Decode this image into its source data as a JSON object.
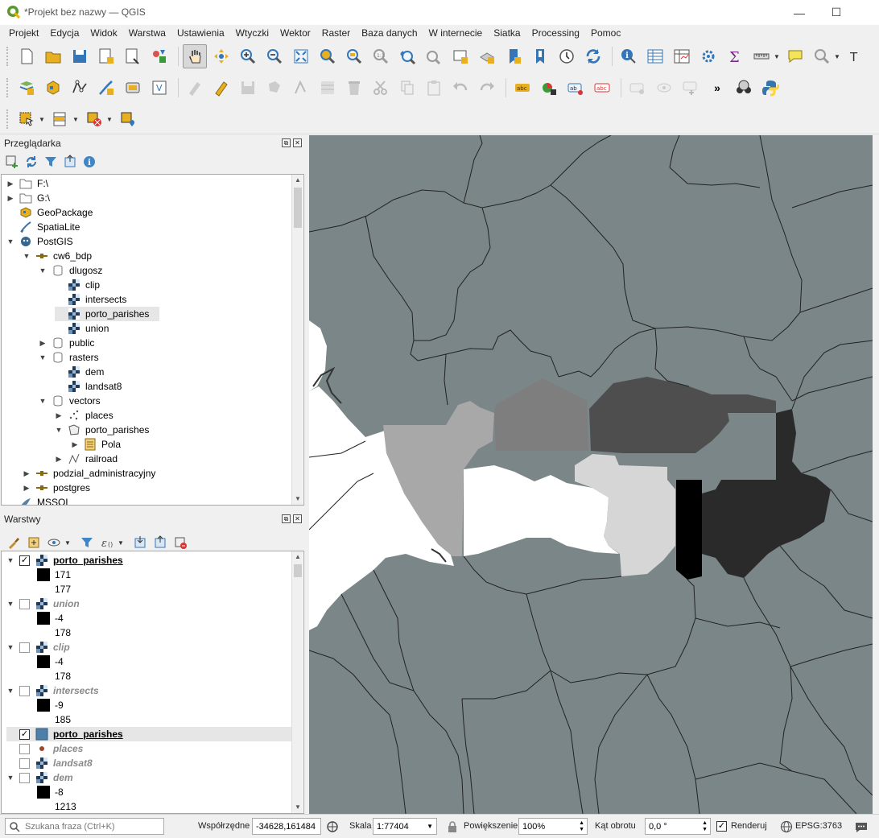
{
  "window": {
    "title": "*Projekt bez nazwy — QGIS",
    "minimize": "—",
    "maximize": "☐"
  },
  "menu": [
    "Projekt",
    "Edycja",
    "Widok",
    "Warstwa",
    "Ustawienia",
    "Wtyczki",
    "Wektor",
    "Raster",
    "Baza danych",
    "W internecie",
    "Siatka",
    "Processing",
    "Pomoc"
  ],
  "toolbar_overflow": "»",
  "browser_panel": {
    "title": "Przeglądarka",
    "items": [
      {
        "label": "F:\\",
        "indent": 0,
        "toggle": "▶",
        "icon": "folder-icon"
      },
      {
        "label": "G:\\",
        "indent": 0,
        "toggle": "▶",
        "icon": "folder-icon"
      },
      {
        "label": "GeoPackage",
        "indent": 0,
        "toggle": "",
        "icon": "geopackage-icon"
      },
      {
        "label": "SpatiaLite",
        "indent": 0,
        "toggle": "",
        "icon": "spatialite-icon"
      },
      {
        "label": "PostGIS",
        "indent": 0,
        "toggle": "▼",
        "icon": "postgis-icon"
      },
      {
        "label": "cw6_bdp",
        "indent": 1,
        "toggle": "▼",
        "icon": "connection-icon"
      },
      {
        "label": "dlugosz",
        "indent": 2,
        "toggle": "▼",
        "icon": "schema-icon"
      },
      {
        "label": "clip",
        "indent": 3,
        "toggle": "",
        "icon": "raster-icon"
      },
      {
        "label": "intersects",
        "indent": 3,
        "toggle": "",
        "icon": "raster-icon"
      },
      {
        "label": "porto_parishes",
        "indent": 3,
        "toggle": "",
        "icon": "raster-icon",
        "selected": true
      },
      {
        "label": "union",
        "indent": 3,
        "toggle": "",
        "icon": "raster-icon"
      },
      {
        "label": "public",
        "indent": 2,
        "toggle": "▶",
        "icon": "schema-icon"
      },
      {
        "label": "rasters",
        "indent": 2,
        "toggle": "▼",
        "icon": "schema-icon"
      },
      {
        "label": "dem",
        "indent": 3,
        "toggle": "",
        "icon": "raster-icon"
      },
      {
        "label": "landsat8",
        "indent": 3,
        "toggle": "",
        "icon": "raster-icon"
      },
      {
        "label": "vectors",
        "indent": 2,
        "toggle": "▼",
        "icon": "schema-icon"
      },
      {
        "label": "places",
        "indent": 3,
        "toggle": "▶",
        "icon": "point-layer-icon"
      },
      {
        "label": "porto_parishes",
        "indent": 3,
        "toggle": "▼",
        "icon": "polygon-layer-icon"
      },
      {
        "label": "Pola",
        "indent": 4,
        "toggle": "▶",
        "icon": "fields-icon"
      },
      {
        "label": "railroad",
        "indent": 3,
        "toggle": "▶",
        "icon": "line-layer-icon"
      },
      {
        "label": "podzial_administracyjny",
        "indent": 1,
        "toggle": "▶",
        "icon": "connection-icon"
      },
      {
        "label": "postgres",
        "indent": 1,
        "toggle": "▶",
        "icon": "connection-icon"
      },
      {
        "label": "MSSQL",
        "indent": 0,
        "toggle": "",
        "icon": "mssql-icon"
      }
    ]
  },
  "layers_panel": {
    "title": "Warstwy",
    "rows": [
      {
        "kind": "layer",
        "name": "porto_parishes",
        "checked": true,
        "style": "bold",
        "toggle": "▼",
        "icon": "raster-icon"
      },
      {
        "kind": "value",
        "text": "171",
        "swatch": true
      },
      {
        "kind": "value",
        "text": "177",
        "swatch": false
      },
      {
        "kind": "layer",
        "name": "union",
        "checked": false,
        "style": "italic",
        "toggle": "▼",
        "icon": "raster-icon"
      },
      {
        "kind": "value",
        "text": "-4",
        "swatch": true
      },
      {
        "kind": "value",
        "text": "178",
        "swatch": false
      },
      {
        "kind": "layer",
        "name": "clip",
        "checked": false,
        "style": "italic",
        "toggle": "▼",
        "icon": "raster-icon"
      },
      {
        "kind": "value",
        "text": "-4",
        "swatch": true
      },
      {
        "kind": "value",
        "text": "178",
        "swatch": false
      },
      {
        "kind": "layer",
        "name": "intersects",
        "checked": false,
        "style": "italic",
        "toggle": "▼",
        "icon": "raster-icon"
      },
      {
        "kind": "value",
        "text": "-9",
        "swatch": true
      },
      {
        "kind": "value",
        "text": "185",
        "swatch": false
      },
      {
        "kind": "layer",
        "name": "porto_parishes",
        "checked": true,
        "style": "bold",
        "toggle": "",
        "icon": "polygon-fill-icon",
        "selected": true
      },
      {
        "kind": "layer",
        "name": "places",
        "checked": false,
        "style": "italic",
        "toggle": "",
        "icon": "point-dot-icon"
      },
      {
        "kind": "layer",
        "name": "landsat8",
        "checked": false,
        "style": "italic",
        "toggle": "",
        "icon": "raster-icon"
      },
      {
        "kind": "layer",
        "name": "dem",
        "checked": false,
        "style": "italic",
        "toggle": "▼",
        "icon": "raster-icon"
      },
      {
        "kind": "value",
        "text": "-8",
        "swatch": true
      },
      {
        "kind": "value",
        "text": "1213",
        "swatch": false
      }
    ]
  },
  "status": {
    "search_placeholder": "Szukana fraza (Ctrl+K)",
    "coord_label": "Współrzędne",
    "coord_value": "-34628,161484",
    "scale_label": "Skala",
    "scale_value": "1:77404",
    "magnifier_label": "Powiększenie",
    "magnifier_value": "100%",
    "rotation_label": "Kąt obrotu",
    "rotation_value": "0,0 °",
    "render_label": "Renderuj",
    "render_checked": true,
    "crs": "EPSG:3763"
  },
  "colors": {
    "map_background": "#7a8687",
    "sea": "#ffffff",
    "accent": "#4d7fa8"
  }
}
